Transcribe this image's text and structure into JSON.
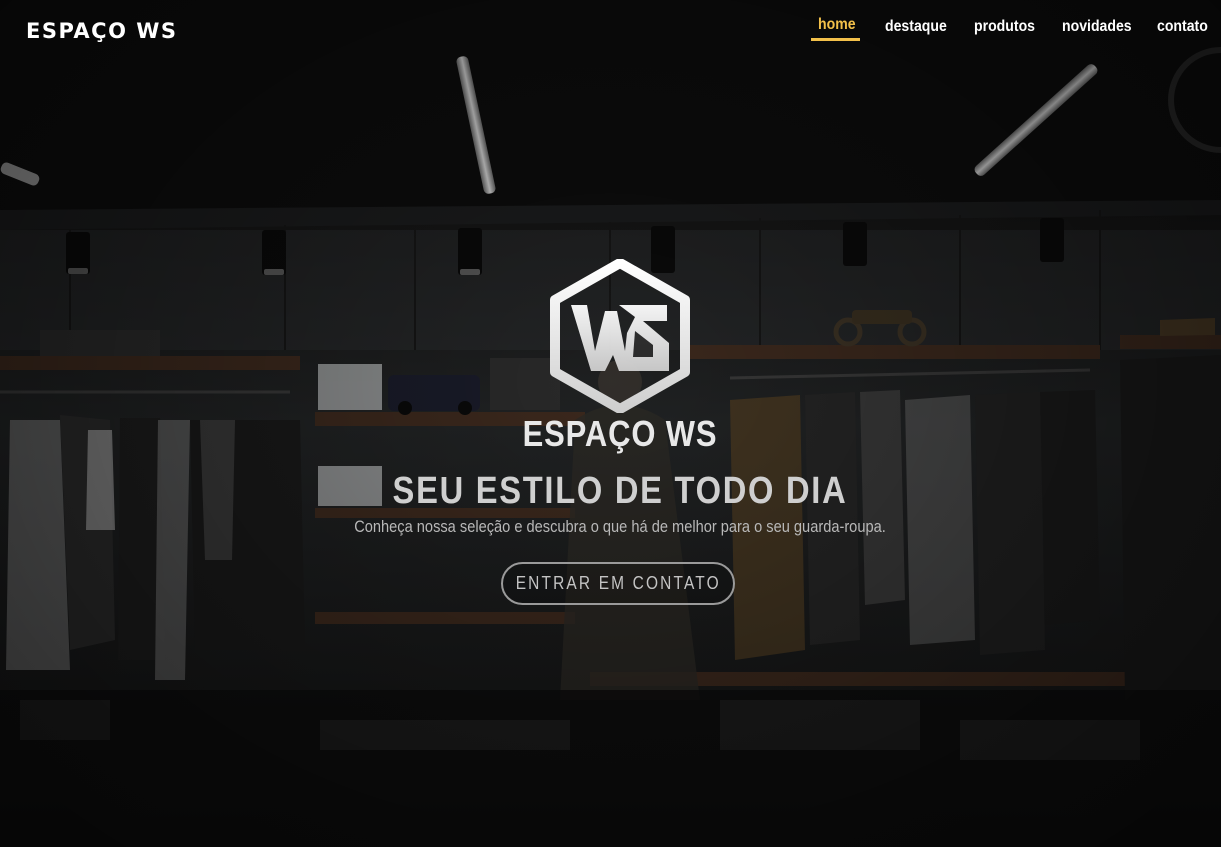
{
  "colors": {
    "accent": "#f2c04a",
    "text": "#ffffff",
    "muted_text": "#b8b8b8"
  },
  "brand": {
    "name": "ESPAÇO WS"
  },
  "nav": {
    "items": [
      {
        "label": "home",
        "active": true
      },
      {
        "label": "destaque",
        "active": false
      },
      {
        "label": "produtos",
        "active": false
      },
      {
        "label": "novidades",
        "active": false
      },
      {
        "label": "contato",
        "active": false
      }
    ]
  },
  "hero": {
    "logo_icon": "ws-hexagon-logo",
    "logo_letters": "WS",
    "logo_text": "ESPAÇO WS",
    "headline": "SEU ESTILO DE TODO DIA",
    "subtitle": "Conheça nossa seleção e descubra o que há de melhor para o seu guarda-roupa.",
    "cta_label": "ENTRAR EM CONTATO"
  }
}
